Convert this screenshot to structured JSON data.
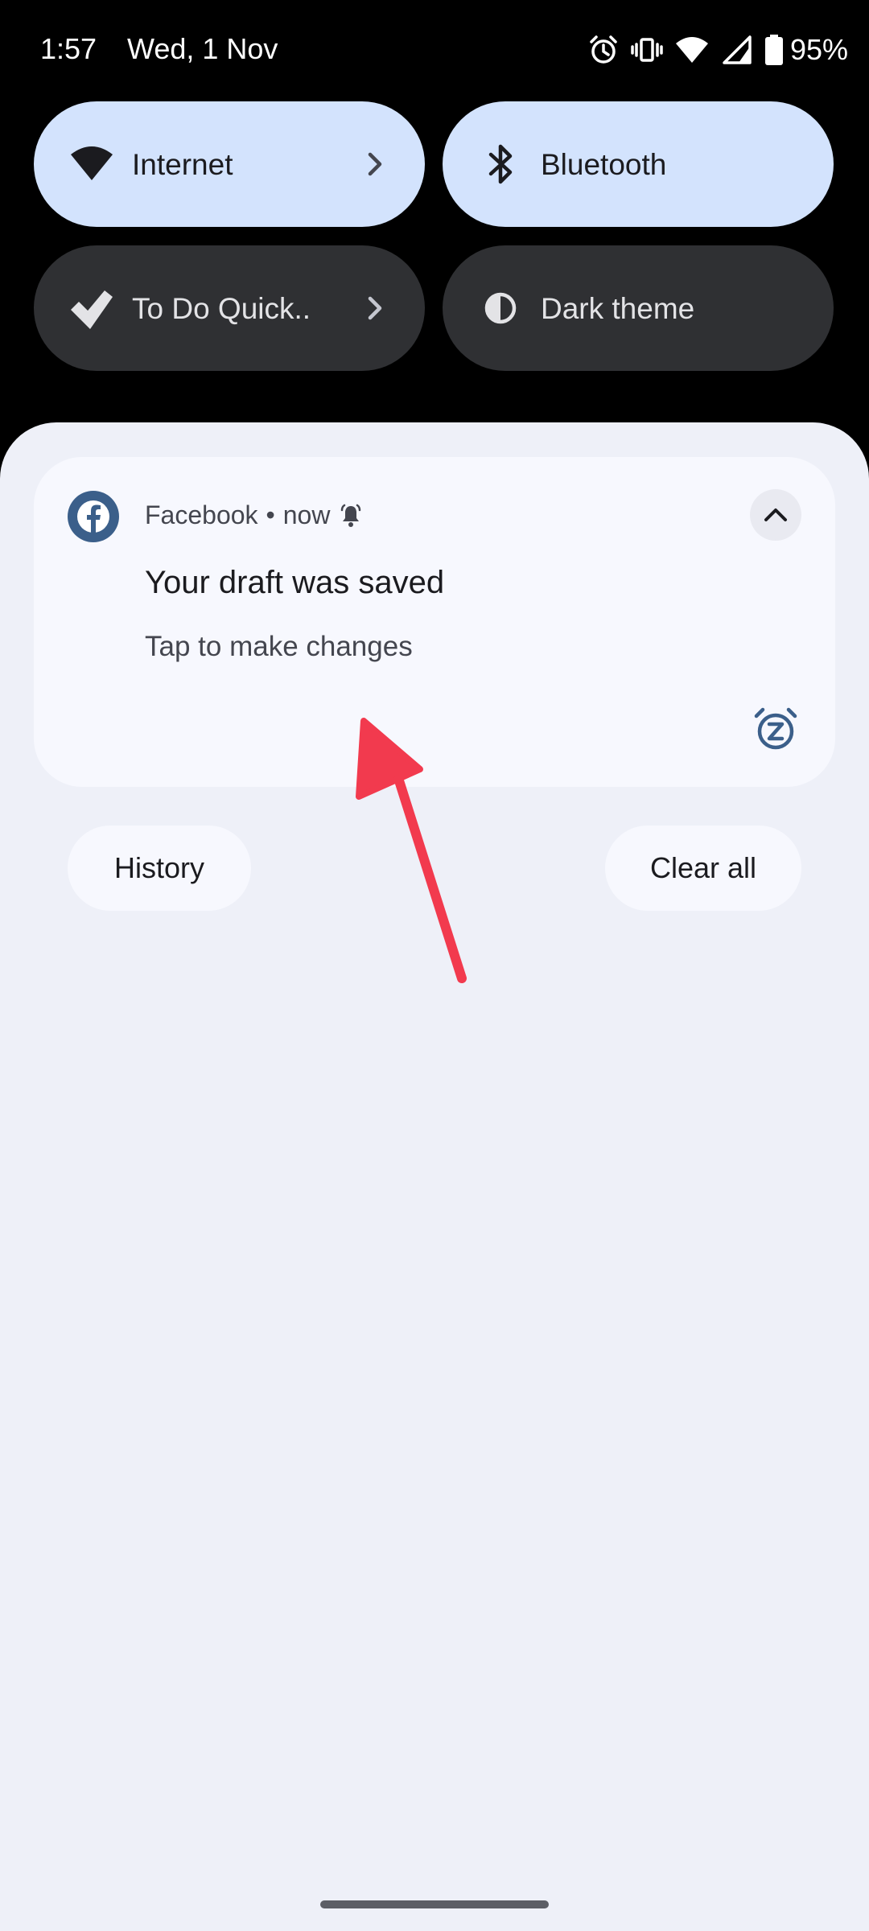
{
  "status_bar": {
    "time": "1:57",
    "date": "Wed, 1 Nov",
    "battery": "95%",
    "icons": [
      "alarm-icon",
      "vibrate-icon",
      "wifi-icon",
      "cellular-signal-icon",
      "battery-icon"
    ]
  },
  "quick_settings": [
    {
      "label": "Internet",
      "icon": "wifi-icon",
      "has_chevron": true,
      "active": true
    },
    {
      "label": "Bluetooth",
      "icon": "bluetooth-icon",
      "has_chevron": false,
      "active": true
    },
    {
      "label": "To Do Quick..",
      "icon": "todo-check-icon",
      "has_chevron": true,
      "active": false
    },
    {
      "label": "Dark theme",
      "icon": "dark-theme-icon",
      "has_chevron": false,
      "active": false
    }
  ],
  "notification": {
    "app": "Facebook",
    "separator": "•",
    "time": "now",
    "title": "Your draft was saved",
    "body": "Tap to make changes"
  },
  "actions": {
    "history": "History",
    "clear_all": "Clear all"
  },
  "colors": {
    "tile_active": "#d3e3fd",
    "tile_inactive": "#2f3033",
    "shade_bg": "#eef0f8",
    "card_bg": "#f7f8fe",
    "facebook_blue": "#3b5f8a",
    "annotation_arrow": "#f23a4e"
  }
}
